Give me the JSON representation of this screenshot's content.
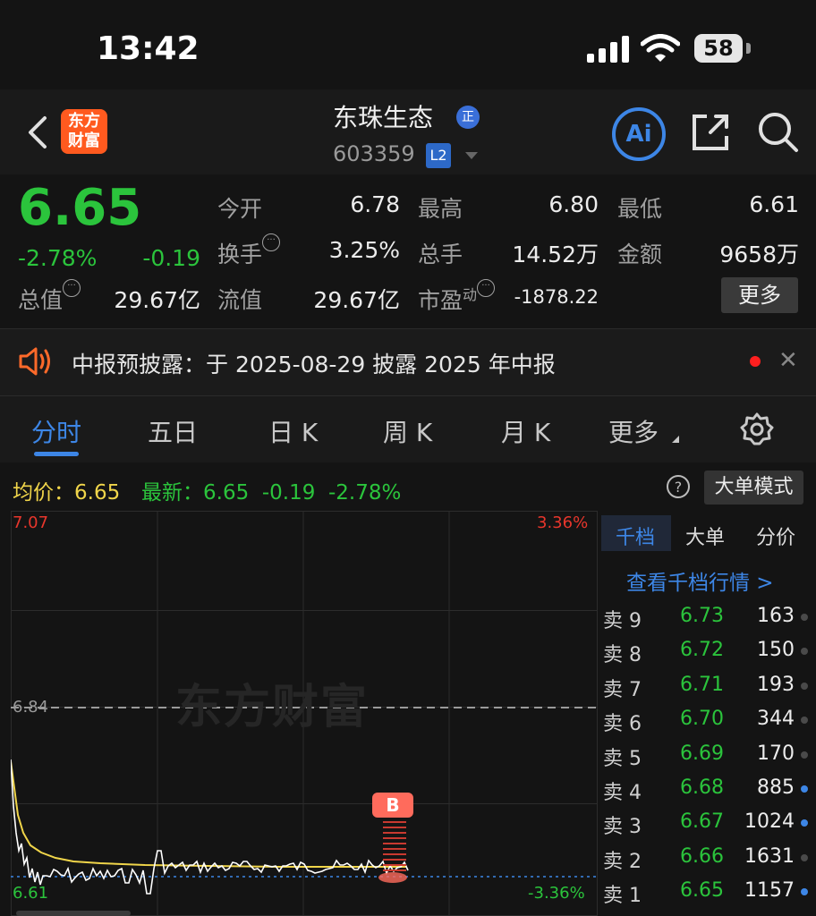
{
  "status_bar": {
    "time": "13:42",
    "battery": "58"
  },
  "header": {
    "logo_line1": "东方",
    "logo_line2": "财富",
    "stock_name": "东珠生态",
    "name_badge": "正",
    "stock_code": "603359",
    "level_badge": "L2",
    "ai_label": "Ai"
  },
  "quote": {
    "price": "6.65",
    "change_pct": "-2.78%",
    "change": "-0.19",
    "open_label": "今开",
    "open": "6.78",
    "high_label": "最高",
    "high": "6.80",
    "low_label": "最低",
    "low": "6.61",
    "turnover_label": "换手",
    "turnover": "3.25%",
    "volume_label": "总手",
    "volume": "14.52万",
    "amount_label": "金额",
    "amount": "9658万",
    "mcap_label": "总值",
    "mcap": "29.67亿",
    "float_label": "流值",
    "float": "29.67亿",
    "pe_label": "市盈",
    "pe_suffix": "动",
    "pe": "-1878.22",
    "more_label": "更多"
  },
  "notice": {
    "text": "中报预披露：于 2025-08-29 披露 2025 年中报"
  },
  "tabs": [
    {
      "label": "分时"
    },
    {
      "label": "五日"
    },
    {
      "label": "日 K"
    },
    {
      "label": "周 K"
    },
    {
      "label": "月 K"
    },
    {
      "label": "更多"
    }
  ],
  "info": {
    "avg_label": "均价：",
    "avg": "6.65",
    "latest_label": "最新：",
    "latest": "6.65",
    "change": "-0.19",
    "change_pct": "-2.78%",
    "bigorder_label": "大单模式"
  },
  "chart": {
    "y_top": "7.07",
    "y_mid": "6.84",
    "y_bottom": "6.61",
    "pct_top": "3.36%",
    "pct_bottom": "-3.36%",
    "watermark": "东方财富",
    "marker": "B",
    "colors": {
      "price": "#ffffff",
      "avg": "#f0d54a",
      "grid": "#2c2c2c",
      "ref": "#9a9a9a"
    }
  },
  "book": {
    "tabs": [
      {
        "label": "千档"
      },
      {
        "label": "大单"
      },
      {
        "label": "分价"
      }
    ],
    "link": "查看千档行情 >",
    "rows": [
      {
        "label": "卖 9",
        "price": "6.73",
        "vol": "163",
        "dot": "grey"
      },
      {
        "label": "卖 8",
        "price": "6.72",
        "vol": "150",
        "dot": "grey"
      },
      {
        "label": "卖 7",
        "price": "6.71",
        "vol": "193",
        "dot": "grey"
      },
      {
        "label": "卖 6",
        "price": "6.70",
        "vol": "344",
        "dot": "grey"
      },
      {
        "label": "卖 5",
        "price": "6.69",
        "vol": "170",
        "dot": "grey"
      },
      {
        "label": "卖 4",
        "price": "6.68",
        "vol": "885",
        "dot": "blue"
      },
      {
        "label": "卖 3",
        "price": "6.67",
        "vol": "1024",
        "dot": "blue"
      },
      {
        "label": "卖 2",
        "price": "6.66",
        "vol": "1631",
        "dot": "grey"
      },
      {
        "label": "卖 1",
        "price": "6.65",
        "vol": "1157",
        "dot": "blue"
      }
    ]
  }
}
